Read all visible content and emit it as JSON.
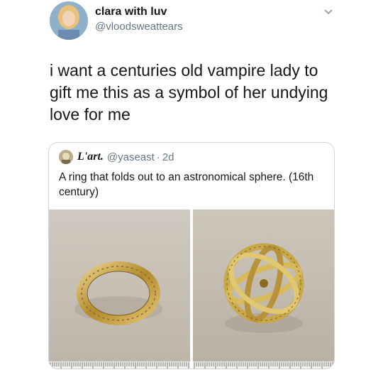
{
  "tweet": {
    "author": {
      "display_name": "clara with luv",
      "handle": "@vloodsweattears"
    },
    "text": "i want a centuries old vampire lady to gift me this as a symbol of her undying love for me",
    "menu_icon": "chevron-down-icon"
  },
  "quoted_tweet": {
    "display_name": "L'art.",
    "handle": "@yaseast",
    "separator": "·",
    "time": "2d",
    "text": "A ring that folds out to an astronomical sphere. (16th century)",
    "media": [
      {
        "kind": "photo",
        "subject": "closed-gold-ring"
      },
      {
        "kind": "photo",
        "subject": "open-astronomical-sphere-ring"
      }
    ]
  },
  "colors": {
    "text_primary": "#14171a",
    "text_secondary": "#657786",
    "border": "#ccd6dd",
    "photo_background": "#c7c0b5",
    "gold": "#c9a84a"
  }
}
